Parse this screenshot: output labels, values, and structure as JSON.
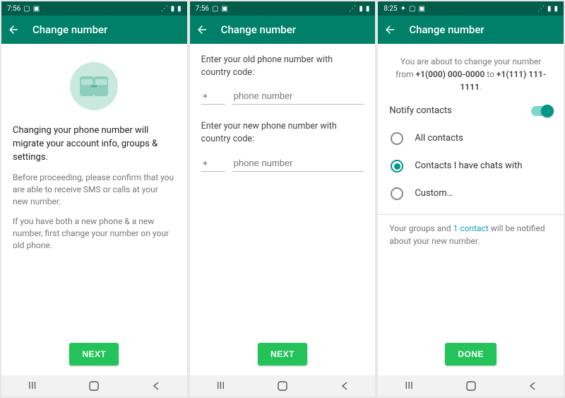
{
  "screens": [
    {
      "status": {
        "time": "7:56"
      },
      "header": {
        "title": "Change number"
      },
      "intro": {
        "headline": "Changing your phone number will migrate your account info, groups & settings.",
        "para1": "Before proceeding, please confirm that you are able to receive SMS or calls at your new number.",
        "para2": "If you have both a new phone & a new number, first change your number on your old phone."
      },
      "button": "NEXT"
    },
    {
      "status": {
        "time": "7:56"
      },
      "header": {
        "title": "Change number"
      },
      "form": {
        "old_label": "Enter your old phone number with country code:",
        "new_label": "Enter your new phone number with country code:",
        "plus": "+",
        "placeholder": "phone number"
      },
      "button": "NEXT"
    },
    {
      "status": {
        "time": "8:25"
      },
      "header": {
        "title": "Change number"
      },
      "confirm": {
        "prefix": "You are about to change your number from ",
        "old_number": "+1(000) 000-0000",
        "mid": " to ",
        "new_number": "+1(111) 111-1111",
        "suffix": "."
      },
      "notify": {
        "title": "Notify contacts",
        "options": {
          "all": "All contacts",
          "chats": "Contacts I have chats with",
          "custom": "Custom…"
        },
        "footer_a": "Your groups and ",
        "footer_link": "1 contact",
        "footer_b": " will be notified about your new number."
      },
      "button": "DONE"
    }
  ]
}
